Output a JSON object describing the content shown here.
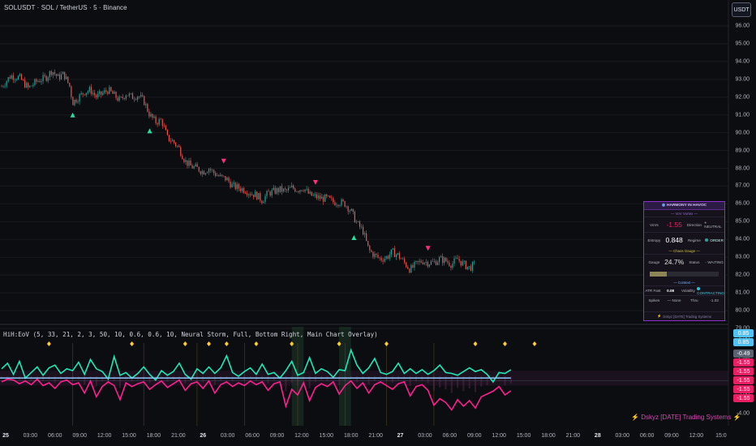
{
  "header": {
    "symbol_title": "SOLUSDT · SOL / TetherUS · 5 · Binance",
    "currency_button": "USDT"
  },
  "price_axis": {
    "labels": [
      "96.00",
      "95.00",
      "94.00",
      "93.00",
      "92.00",
      "91.00",
      "90.00",
      "89.00",
      "88.00",
      "87.00",
      "86.00",
      "85.00",
      "84.00",
      "83.00",
      "82.00",
      "81.00",
      "80.00",
      "79.00"
    ]
  },
  "indicator": {
    "label": "HiH:EoV (5, 33, 21, 2, 3, 50, 10, 0.6, 0.6, 10, Neural Storm, Full, Bottom Right, Main Chart Overlay)",
    "axis_labels": [
      "4.00",
      "2.00",
      "-2.00",
      "-4.00"
    ],
    "badges": [
      {
        "text": "0.85",
        "color": "#4fc3f7"
      },
      {
        "text": "0.85",
        "color": "#4fc3f7"
      },
      {
        "text": "-0.49",
        "color": "#5a6270"
      },
      {
        "text": "-1.55",
        "color": "#e91e63"
      },
      {
        "text": "-1.55",
        "color": "#e91e63"
      },
      {
        "text": "-1.55",
        "color": "#e91e63"
      },
      {
        "text": "-1.55",
        "color": "#e91e63"
      },
      {
        "text": "-1.55",
        "color": "#e91e63"
      }
    ]
  },
  "time_axis": {
    "labels": [
      "25",
      "03:00",
      "06:00",
      "09:00",
      "12:00",
      "15:00",
      "18:00",
      "21:00",
      "26",
      "03:00",
      "06:00",
      "09:00",
      "12:00",
      "15:00",
      "18:00",
      "21:00",
      "27",
      "03:00",
      "06:00",
      "09:00",
      "12:00",
      "15:00",
      "18:00",
      "21:00",
      "28",
      "03:00",
      "06:00",
      "09:00",
      "12:00",
      "15:0"
    ]
  },
  "watermark": {
    "bolt_left": "⚡",
    "text": "Dskyz [DATE] Trading Systems",
    "bolt_right": "⚡"
  },
  "hud": {
    "title": "HARMONY IN HAVOC",
    "sec_vortex": "— VoV Vortex —",
    "vovs_label": "VoVs",
    "vovs_value": "-1.55",
    "direction_label": "Direction",
    "direction_value": "NEUTRAL",
    "entropy_label": "Entropy",
    "entropy_value": "0.848",
    "regime_label": "Regime",
    "regime_value": "ORDER",
    "sec_chaos": "— Chaos Gauge —",
    "gauge_label": "Gauge",
    "gauge_value": "24.7%",
    "gauge_fill_pct": 24.7,
    "status_label": "Status",
    "status_value": "WAITING",
    "sec_context": "— Context —",
    "atr_label": "ATR Fast",
    "atr_value": "0.08",
    "volatility_label": "Volatility",
    "volatility_value": "CONTRACTING",
    "spikes_label": "Spikes",
    "spikes_value": "— None",
    "thru_label": "Thru",
    "thru_value": "-1.03",
    "footer": "Dskyz [DATE] Trading Systems",
    "colors": {
      "vovs": "#e91e63",
      "order": "#26a69a",
      "gauge": "#8d8556",
      "border": "#8f2ecf",
      "title": "#d7c8ff"
    }
  },
  "chart_data": [
    {
      "type": "candlestick",
      "series_color_up": "#26a69a",
      "series_color_down": "#ef5350",
      "ylim": [
        79,
        96.5
      ],
      "x_range": [
        0,
        100
      ],
      "price_path": [
        [
          0,
          92.6
        ],
        [
          1.5,
          93.2
        ],
        [
          3,
          93.1
        ],
        [
          4.5,
          92.5
        ],
        [
          6,
          92.9
        ],
        [
          7.5,
          93.1
        ],
        [
          8.5,
          93.5
        ],
        [
          9.5,
          93.1
        ],
        [
          10.5,
          93.3
        ],
        [
          11.5,
          92.6
        ],
        [
          12,
          91.7
        ],
        [
          13,
          92.0
        ],
        [
          14,
          92.3
        ],
        [
          15,
          92.4
        ],
        [
          16,
          92.0
        ],
        [
          17,
          92.2
        ],
        [
          18,
          92.4
        ],
        [
          19,
          92.1
        ],
        [
          20,
          91.8
        ],
        [
          21,
          92.2
        ],
        [
          22,
          92.0
        ],
        [
          23,
          92.1
        ],
        [
          24,
          91.8
        ],
        [
          25,
          91.0
        ],
        [
          26,
          90.6
        ],
        [
          27,
          90.7
        ],
        [
          28,
          89.7
        ],
        [
          29,
          89.5
        ],
        [
          30,
          89.1
        ],
        [
          31,
          88.4
        ],
        [
          32,
          88.1
        ],
        [
          33,
          88.0
        ],
        [
          34,
          87.8
        ],
        [
          35,
          88.0
        ],
        [
          36,
          87.7
        ],
        [
          37,
          87.5
        ],
        [
          38,
          87.4
        ],
        [
          39,
          87.0
        ],
        [
          40,
          86.9
        ],
        [
          41,
          86.8
        ],
        [
          42,
          86.6
        ],
        [
          43,
          86.5
        ],
        [
          44,
          86.2
        ],
        [
          45,
          86.6
        ],
        [
          46,
          86.7
        ],
        [
          47,
          86.8
        ],
        [
          48,
          86.7
        ],
        [
          49,
          86.9
        ],
        [
          50,
          86.8
        ],
        [
          51,
          86.9
        ],
        [
          52,
          86.5
        ],
        [
          53,
          86.4
        ],
        [
          54,
          86.3
        ],
        [
          55,
          86.3
        ],
        [
          56,
          86.1
        ],
        [
          57,
          86.1
        ],
        [
          58,
          86.0
        ],
        [
          59,
          85.6
        ],
        [
          60,
          84.9
        ],
        [
          61,
          84.5
        ],
        [
          62,
          83.4
        ],
        [
          63,
          83.1
        ],
        [
          64,
          82.9
        ],
        [
          65,
          83.0
        ],
        [
          66,
          83.3
        ],
        [
          67,
          83.1
        ],
        [
          68,
          82.7
        ],
        [
          69,
          82.3
        ],
        [
          70,
          82.6
        ],
        [
          71,
          82.8
        ],
        [
          72,
          82.7
        ],
        [
          73,
          82.7
        ],
        [
          74,
          82.9
        ],
        [
          75,
          82.8
        ],
        [
          76,
          82.6
        ],
        [
          77,
          82.9
        ],
        [
          78,
          82.6
        ],
        [
          79,
          82.4
        ],
        [
          80,
          82.6
        ]
      ],
      "markers": [
        {
          "x": 12,
          "y": 91.0,
          "kind": "up",
          "color": "#26e0a0"
        },
        {
          "x": 25,
          "y": 90.1,
          "kind": "up",
          "color": "#26e0a0"
        },
        {
          "x": 37.5,
          "y": 88.4,
          "kind": "down",
          "color": "#ff2e7e"
        },
        {
          "x": 53,
          "y": 87.2,
          "kind": "down",
          "color": "#ff2e7e"
        },
        {
          "x": 59.5,
          "y": 84.1,
          "kind": "up",
          "color": "#26e0a0"
        },
        {
          "x": 72,
          "y": 83.5,
          "kind": "down",
          "color": "#ff2e7e"
        }
      ]
    },
    {
      "type": "line",
      "ylim": [
        -4.6,
        4.6
      ],
      "zero_line": -0.49,
      "series": [
        {
          "color": "#1de9b6",
          "values": [
            0.8,
            1.4,
            0.2,
            1.6,
            -0.2,
            0.4,
            1.0,
            0.1,
            0.9,
            1.2,
            0.3,
            0.8,
            0.6,
            1.5,
            0.2,
            1.8,
            0.8,
            0.5,
            -0.3,
            2.1,
            0.1,
            0.4,
            -0.2,
            0.3,
            1.0,
            0.2,
            -0.4,
            0.6,
            0.1,
            0.5,
            1.4,
            0.2,
            -0.3,
            0.8,
            0.3,
            1.0,
            0.3,
            0.9,
            2.2,
            0.4,
            0.0,
            0.5,
            0.9,
            0.2,
            1.3,
            0.2,
            0.4,
            -0.2,
            0.6,
            1.6,
            0.1,
            0.4,
            2.0,
            0.3,
            0.8,
            0.5,
            -0.1,
            0.7,
            0.6,
            2.8,
            1.2,
            0.3,
            0.9,
            1.9,
            0.4,
            0.2,
            0.5,
            1.4,
            0.3,
            0.8,
            0.3,
            0.7,
            0.2,
            0.6,
            1.2,
            0.4,
            0.3,
            0.1,
            0.5,
            0.9,
            0.5,
            0.7,
            0.2,
            -0.6,
            0.4,
            0.3,
            0.7
          ]
        },
        {
          "color": "#ff1f8f",
          "values": [
            -0.6,
            -0.3,
            -0.4,
            -0.8,
            -0.5,
            -0.9,
            -0.3,
            -1.0,
            -0.7,
            -1.3,
            -0.6,
            -0.4,
            -0.9,
            -0.7,
            -1.8,
            -0.5,
            -2.2,
            -1.1,
            -0.6,
            -1.0,
            -2.5,
            -0.7,
            -1.1,
            -0.8,
            -0.6,
            -1.4,
            -0.9,
            -0.5,
            -1.2,
            -0.8,
            -0.4,
            -1.5,
            -0.8,
            -0.6,
            -1.3,
            -0.5,
            -1.8,
            -0.9,
            -0.6,
            -1.1,
            -0.7,
            -1.0,
            -0.5,
            -0.9,
            -0.6,
            -1.5,
            -0.8,
            -0.6,
            -3.2,
            -1.4,
            -2.0,
            -0.7,
            -2.6,
            -1.2,
            -0.8,
            -1.1,
            -0.6,
            -1.9,
            -1.0,
            -0.5,
            -1.3,
            -0.7,
            -1.8,
            -0.9,
            -0.6,
            -1.0,
            -1.4,
            -0.8,
            -0.6,
            -2.1,
            -1.1,
            -0.9,
            -1.5,
            -3.1,
            -2.4,
            -2.8,
            -3.6,
            -2.5,
            -3.2,
            -2.6,
            -3.4,
            -2.2,
            -1.9,
            -1.6,
            -1.1,
            -2.0,
            -1.55
          ]
        },
        {
          "color": "#8fc8ff",
          "values": [
            0.85
          ]
        }
      ],
      "diamonds_x": [
        8,
        22,
        31,
        35,
        38,
        43,
        49,
        57,
        65,
        80,
        85,
        90
      ],
      "diamond_color": "#ffcc33",
      "vline_x": [
        12,
        24,
        33,
        41,
        50,
        58,
        65,
        73
      ],
      "highlight_x": [
        [
          49,
          51
        ],
        [
          57,
          59
        ]
      ]
    }
  ]
}
